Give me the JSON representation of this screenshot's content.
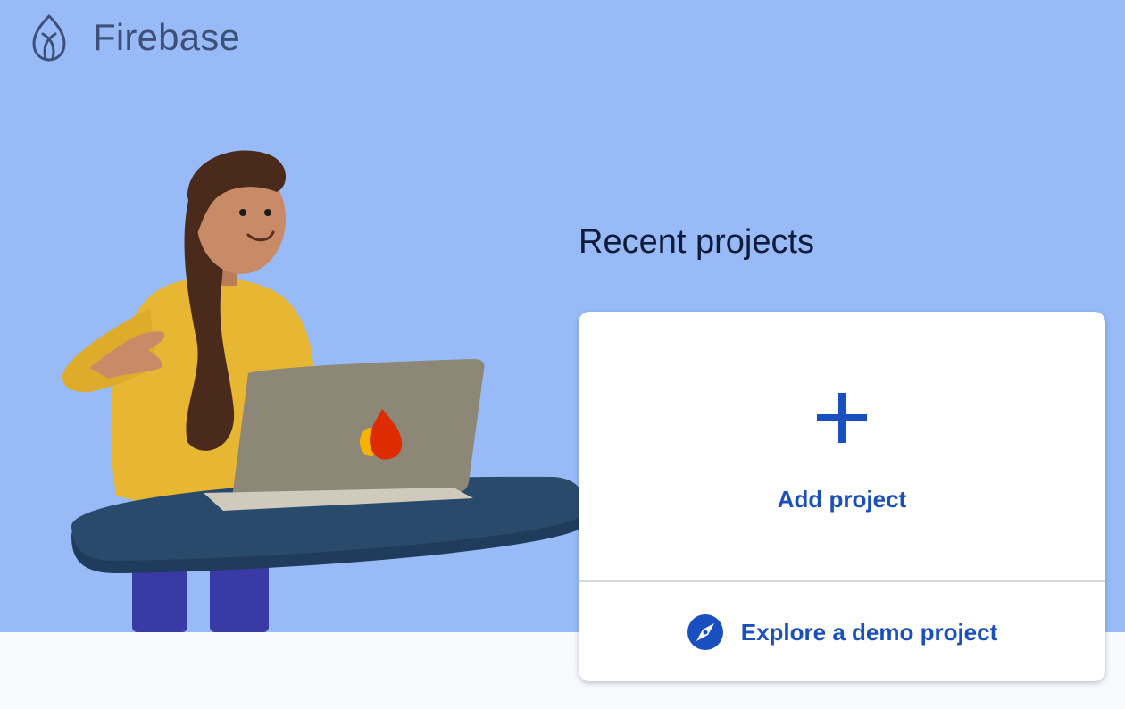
{
  "app": {
    "name": "Firebase",
    "logo_icon": "firebase-flame-icon"
  },
  "hero": {
    "illustration": "person-with-laptop-illustration"
  },
  "recent_projects": {
    "title": "Recent projects",
    "add_project": {
      "label": "Add project",
      "icon": "plus-icon"
    },
    "explore_demo": {
      "label": "Explore a demo project",
      "icon": "compass-icon"
    }
  },
  "colors": {
    "hero_background": "#98bbf8",
    "page_background": "#f8f9fc",
    "accent": "#1a4fbf",
    "title_text": "#0e1b3a",
    "logo_text": "#3e5078"
  }
}
